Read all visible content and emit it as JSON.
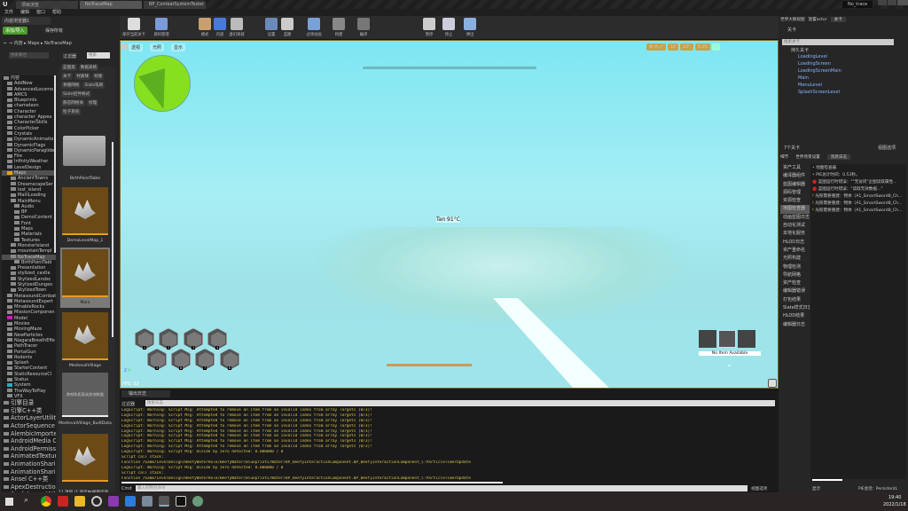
{
  "window": {
    "tabs": [
      "项目浏览",
      "NoTraceMap",
      "BP_CombatSystemTester"
    ],
    "project": "No_trace"
  },
  "menu": [
    "文件",
    "编辑",
    "窗口",
    "帮助"
  ],
  "content_browser": {
    "tab": "内容浏览器1",
    "add_import": "添加/导入",
    "save_all": "保存所有",
    "breadcrumb": [
      "内容",
      "Maps",
      "NoTraceMap"
    ],
    "search_placeholder": "搜索路径",
    "filter_label": "过滤器",
    "asset_search_placeholder": "搜索",
    "tree": [
      {
        "label": "内容",
        "d": 0
      },
      {
        "label": "AddNew",
        "d": 1
      },
      {
        "label": "AdvancedLocomo",
        "d": 1
      },
      {
        "label": "AMCS",
        "d": 1
      },
      {
        "label": "Blueprints",
        "d": 1
      },
      {
        "label": "chameleon",
        "d": 1
      },
      {
        "label": "Character",
        "d": 1
      },
      {
        "label": "character_Appea",
        "d": 1
      },
      {
        "label": "CharacterSkills",
        "d": 1
      },
      {
        "label": "ColorPicker",
        "d": 1
      },
      {
        "label": "Crystals",
        "d": 1
      },
      {
        "label": "DynamicAnimatio",
        "d": 1
      },
      {
        "label": "DynamicFlags",
        "d": 1
      },
      {
        "label": "DynamicParaglide",
        "d": 1
      },
      {
        "label": "Fire",
        "d": 1
      },
      {
        "label": "InfinityWeather",
        "d": 1
      },
      {
        "label": "LevelDesign",
        "d": 1
      },
      {
        "label": "Maps",
        "d": 1,
        "sel": true
      },
      {
        "label": "AncientTowns",
        "d": 2
      },
      {
        "label": "DreamscapeSer",
        "d": 2
      },
      {
        "label": "lost_island",
        "d": 2
      },
      {
        "label": "MainLoading",
        "d": 2
      },
      {
        "label": "MainMenu",
        "d": 2
      },
      {
        "label": "Audio",
        "d": 3
      },
      {
        "label": "BP",
        "d": 3
      },
      {
        "label": "DemoContent",
        "d": 3
      },
      {
        "label": "Font",
        "d": 3
      },
      {
        "label": "Maps",
        "d": 3
      },
      {
        "label": "Materials",
        "d": 3
      },
      {
        "label": "Textures",
        "d": 3
      },
      {
        "label": "MonsterIsland",
        "d": 2
      },
      {
        "label": "mountainTempl",
        "d": 2
      },
      {
        "label": "NoTraceMap",
        "d": 2,
        "sel": true
      },
      {
        "label": "BirthPointTabl",
        "d": 3
      },
      {
        "label": "Presentation",
        "d": 2
      },
      {
        "label": "stylized_castle",
        "d": 2
      },
      {
        "label": "StylizedLandsc",
        "d": 2
      },
      {
        "label": "StylizedDungeo",
        "d": 2
      },
      {
        "label": "StylizedTown",
        "d": 2
      },
      {
        "label": "MetasoundCombat",
        "d": 1
      },
      {
        "label": "MetasoundExpert",
        "d": 1
      },
      {
        "label": "MinableRocks",
        "d": 1
      },
      {
        "label": "MissionComponen",
        "d": 1
      },
      {
        "label": "Model",
        "d": 1,
        "color": "#c020c0"
      },
      {
        "label": "Movies",
        "d": 1
      },
      {
        "label": "MovingMaze",
        "d": 1
      },
      {
        "label": "NewParticles",
        "d": 1
      },
      {
        "label": "NiagaraBreathEffe",
        "d": 1
      },
      {
        "label": "PathTracer",
        "d": 1
      },
      {
        "label": "PortalGun",
        "d": 1
      },
      {
        "label": "Rodents",
        "d": 1
      },
      {
        "label": "Splash",
        "d": 1
      },
      {
        "label": "StarterContent",
        "d": 1
      },
      {
        "label": "StaticResourceCl",
        "d": 1
      },
      {
        "label": "Status",
        "d": 1
      },
      {
        "label": "System",
        "d": 1,
        "color": "#20b0c0"
      },
      {
        "label": "TheWayToPlay",
        "d": 1
      },
      {
        "label": "VFX",
        "d": 1
      },
      {
        "label": "引擎目录",
        "d": 0,
        "big": true
      },
      {
        "label": "引擎C++类",
        "d": 0,
        "big": true
      },
      {
        "label": "ActorLayerUtilit",
        "d": 0,
        "big": true
      },
      {
        "label": "ActorSequence",
        "d": 0,
        "big": true
      },
      {
        "label": "AlembicImporte",
        "d": 0,
        "big": true
      },
      {
        "label": "AndroidMedia C",
        "d": 0,
        "big": true
      },
      {
        "label": "AndroidPermiss",
        "d": 0,
        "big": true
      },
      {
        "label": "AnimatedTextur",
        "d": 0,
        "big": true
      },
      {
        "label": "AnimationShari",
        "d": 0,
        "big": true
      },
      {
        "label": "AnimationShari",
        "d": 0,
        "big": true
      },
      {
        "label": "Ansel C++类",
        "d": 0,
        "big": true
      },
      {
        "label": "ApexDestructio",
        "d": 0,
        "big": true
      },
      {
        "label": "AppleImageUtil",
        "d": 0,
        "big": true
      }
    ],
    "filters": [
      "蓝图类",
      "数据表格",
      "关卡",
      "材质球",
      "材质",
      "骨骼网格",
      "Slate笔刷",
      "Slate控件样式",
      "静态网格体",
      "纹理",
      "粒子系统"
    ],
    "assets": [
      "BirthPointTable",
      "DemoLevelMap_1",
      "Main",
      "MedievalVillage",
      "MedievalVillage_BuiltData"
    ],
    "thumb_text": "跨帧和距离或其他数据",
    "item_count": "11 项目 (1 项选中)",
    "view_options": "视图选项"
  },
  "toolbar": [
    "保存当前关卡",
    "源码管理",
    "模式",
    "内容",
    "虚幻商城",
    "设置",
    "蓝图",
    "过场动画",
    "构建",
    "编译",
    "暂停",
    "停止",
    "弹出"
  ],
  "viewport": {
    "perspective": "透视",
    "lit": "光照",
    "show": "显示",
    "grid_snap": "10",
    "rot_snap": "10°",
    "scale_snap": "0.25",
    "cam_speed": "8",
    "hud_text": "Tan 91°C",
    "fps": "FPS: 32",
    "no_item": "No Item Available",
    "slot_keys": [
      "1",
      "2",
      "3",
      "4",
      "5",
      "6",
      "7",
      "8"
    ]
  },
  "output_log": {
    "tab": "输出日志",
    "filter": "过滤器",
    "search_placeholder": "搜索日志",
    "cmd": "Cmd",
    "cmd_placeholder": "输入控制台命令",
    "lines": [
      {
        "t": "LogScript: Warning: Script Msg: Attempted to remove an item from an invalid index from array Targets [0/3]!",
        "c": "y"
      },
      {
        "t": "LogScript: Warning: Script Msg: Attempted to remove an item from an invalid index from array Targets [0/3]!",
        "c": "y"
      },
      {
        "t": "LogScript: Warning: Script Msg: Attempted to remove an item from an invalid index from array Targets [0/3]!",
        "c": "y"
      },
      {
        "t": "LogScript: Warning: Script Msg: Attempted to remove an item from an invalid index from array Targets [0/3]!",
        "c": "y"
      },
      {
        "t": "LogScript: Warning: Script Msg: Attempted to remove an item from an invalid index from array Targets [0/3]!",
        "c": "y"
      },
      {
        "t": "LogScript: Warning: Script Msg: Attempted to remove an item from an invalid index from array Targets [0/3]!",
        "c": "y"
      },
      {
        "t": "LogScript: Warning: Script Msg: Attempted to remove an item from an invalid index from array Targets [0/3]!",
        "c": "y"
      },
      {
        "t": "LogScript: Warning: Script Msg: Attempted to remove an item from an invalid index from array Targets [0/3]!",
        "c": "y"
      },
      {
        "t": "LogScript: Warning: Script Msg: Divide by zero detected: 0.000000 / 0",
        "c": "y"
      },
      {
        "t": "Script call stack:",
        "c": "y"
      },
      {
        "t": "    Function /Game/LevelDesign/BeefyWaterHole/BeefyWater/Blueprints/Water/BP_BeefyInteractionComponent.BP_BeefyInteractionComponent_C:ParticleTimerUpdate",
        "c": "y"
      },
      {
        "t": "LogScript: Warning: Script Msg: Divide by zero detected: 0.000000 / 0",
        "c": "y"
      },
      {
        "t": "Script call stack:",
        "c": "y"
      },
      {
        "t": "    Function /Game/LevelDesign/BeefyWaterHole/BeefyWater/Blueprints/Water/BP_BeefyInteractionComponent.BP_BeefyInteractionComponent_C:ParticleTimerUpdate",
        "c": "y"
      }
    ],
    "view_options": "视图选项"
  },
  "right": {
    "tabs": [
      "世界大纲视图",
      "放置actor",
      "关卡"
    ],
    "levels_label": "关卡",
    "search_placeholder": "搜索关卡",
    "persistent": "持久关卡",
    "levels": [
      "LoadingLevel",
      "LoadingScreen",
      "LoadingScreenMain",
      "Main",
      "MenuLevel",
      "SplashScreenLevel"
    ],
    "level_count": "7个关卡",
    "view_options": "视图选项",
    "bottom_tabs": [
      "细节",
      "世界场景设置",
      "消息日志"
    ],
    "categories": [
      "资产工具",
      "编译器组件",
      "蓝图编辑器",
      "源码管理",
      "资源检查",
      "地图检查器",
      "动画蓝图日志",
      "自动化测试",
      "本地化服务",
      "HLOD日志",
      "资产重命名",
      "光照构建",
      "物理检测",
      "导航网格",
      "资产检查",
      "编辑器错误",
      "打包结果",
      "Slate样式日志",
      "HLOD结果",
      "编辑器日志"
    ],
    "messages": [
      {
        "t": "地图检查器",
        "k": "info"
      },
      {
        "t": "PIE总计时间：0.53秒。",
        "k": "info"
      },
      {
        "t": "蓝图运行时错误：\"\"无访问\"企图读取属性...",
        "k": "error"
      },
      {
        "t": "蓝图运行时错误：\"读取无效数据...\"",
        "k": "error"
      },
      {
        "t": "光照需要重建：物体（A1_SmartSword8_Ch...",
        "k": "warn"
      },
      {
        "t": "光照需要重建：物体（A1_SmartSword8_Ch...",
        "k": "warn"
      },
      {
        "t": "光照需要重建：物体（A1_SmartSword8_Ch...",
        "k": "warn"
      }
    ],
    "show": "显示",
    "page": "PIE会话：PersistentL"
  },
  "taskbar": {
    "time": "19:40",
    "date": "2022/1/18"
  }
}
